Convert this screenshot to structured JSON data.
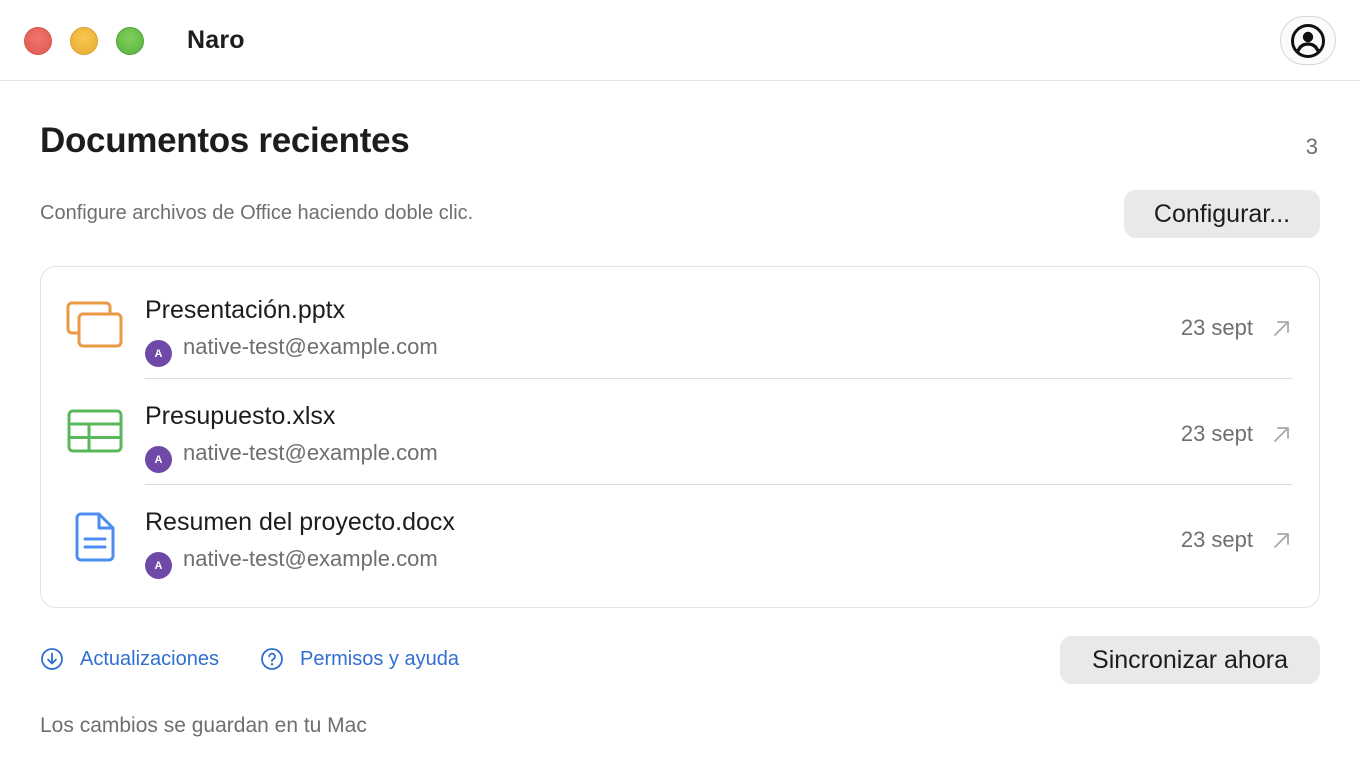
{
  "window": {
    "app_title": "Naro",
    "icons": {
      "account": "account-circle-icon"
    }
  },
  "header": {
    "title": "Documentos recientes",
    "count": "3",
    "subtitle": "Configure archivos de Office haciendo doble clic.",
    "configure_label": "Configurar..."
  },
  "documents": [
    {
      "name": "Presentación.pptx",
      "owner_initial": "A",
      "owner": "native-test@example.com",
      "date": "23 sept",
      "icon": "presentation-icon",
      "color": "#ea9a45"
    },
    {
      "name": "Presupuesto.xlsx",
      "owner_initial": "A",
      "owner": "native-test@example.com",
      "date": "23 sept",
      "icon": "spreadsheet-icon",
      "color": "#5bb85a"
    },
    {
      "name": "Resumen del proyecto.docx",
      "owner_initial": "A",
      "owner": "native-test@example.com",
      "date": "23 sept",
      "icon": "document-icon",
      "color": "#4b8ef0"
    }
  ],
  "footer": {
    "updates_label": "Actualizaciones",
    "help_label": "Permisos y ayuda",
    "sync_label": "Sincronizar ahora",
    "note": "Los cambios se guardan en tu Mac"
  },
  "colors": {
    "accent_link": "#2f6fd2",
    "avatar": "#6f49a8",
    "button_bg": "#e9e9eb"
  }
}
